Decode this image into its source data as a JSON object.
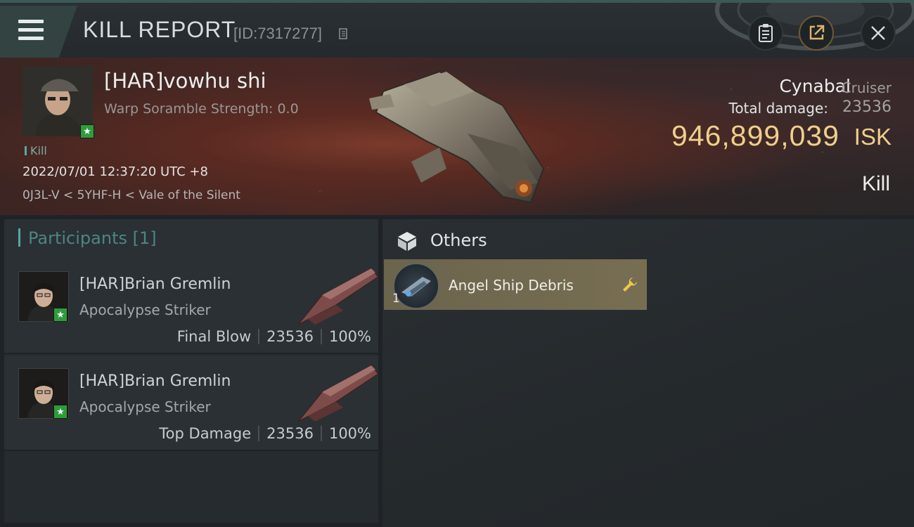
{
  "header": {
    "title": "KILL REPORT",
    "report_id": "[ID:7317277]",
    "menu_icon": "hamburger-menu-icon",
    "buttons": [
      "clipboard-icon",
      "share-icon",
      "close-icon"
    ]
  },
  "victim": {
    "name": "[HAR]vowhu shi",
    "scramble": "Warp Soramble Strength: 0.0",
    "tag": "Kill",
    "time": "2022/07/01 12:37:20 UTC +8",
    "location": "0J3L-V < 5YHF-H < Vale of the Silent",
    "ship_name": "Cynabal",
    "ship_class": "Cruiser",
    "damage_label": "Total damage:",
    "damage_value": "23536",
    "isk_value": "946,899,039",
    "isk_unit": "ISK",
    "result": "Kill"
  },
  "participants": {
    "title": "Participants [1]",
    "rows": [
      {
        "name": "[HAR]Brian Gremlin",
        "ship": "Apocalypse Striker",
        "role": "Final Blow",
        "damage": "23536",
        "percent": "100%"
      },
      {
        "name": "[HAR]Brian Gremlin",
        "ship": "Apocalypse Striker",
        "role": "Top Damage",
        "damage": "23536",
        "percent": "100%"
      }
    ]
  },
  "others": {
    "title": "Others",
    "items": [
      {
        "name": "Angel Ship Debris",
        "quantity": "1",
        "icon": "wrench-icon"
      }
    ]
  },
  "colors": {
    "accent_teal": "#5aa5a3",
    "isk_gold": "#f0cf8a",
    "loot_bg": "#6b644d",
    "badge_green": "#2f9c3c"
  }
}
